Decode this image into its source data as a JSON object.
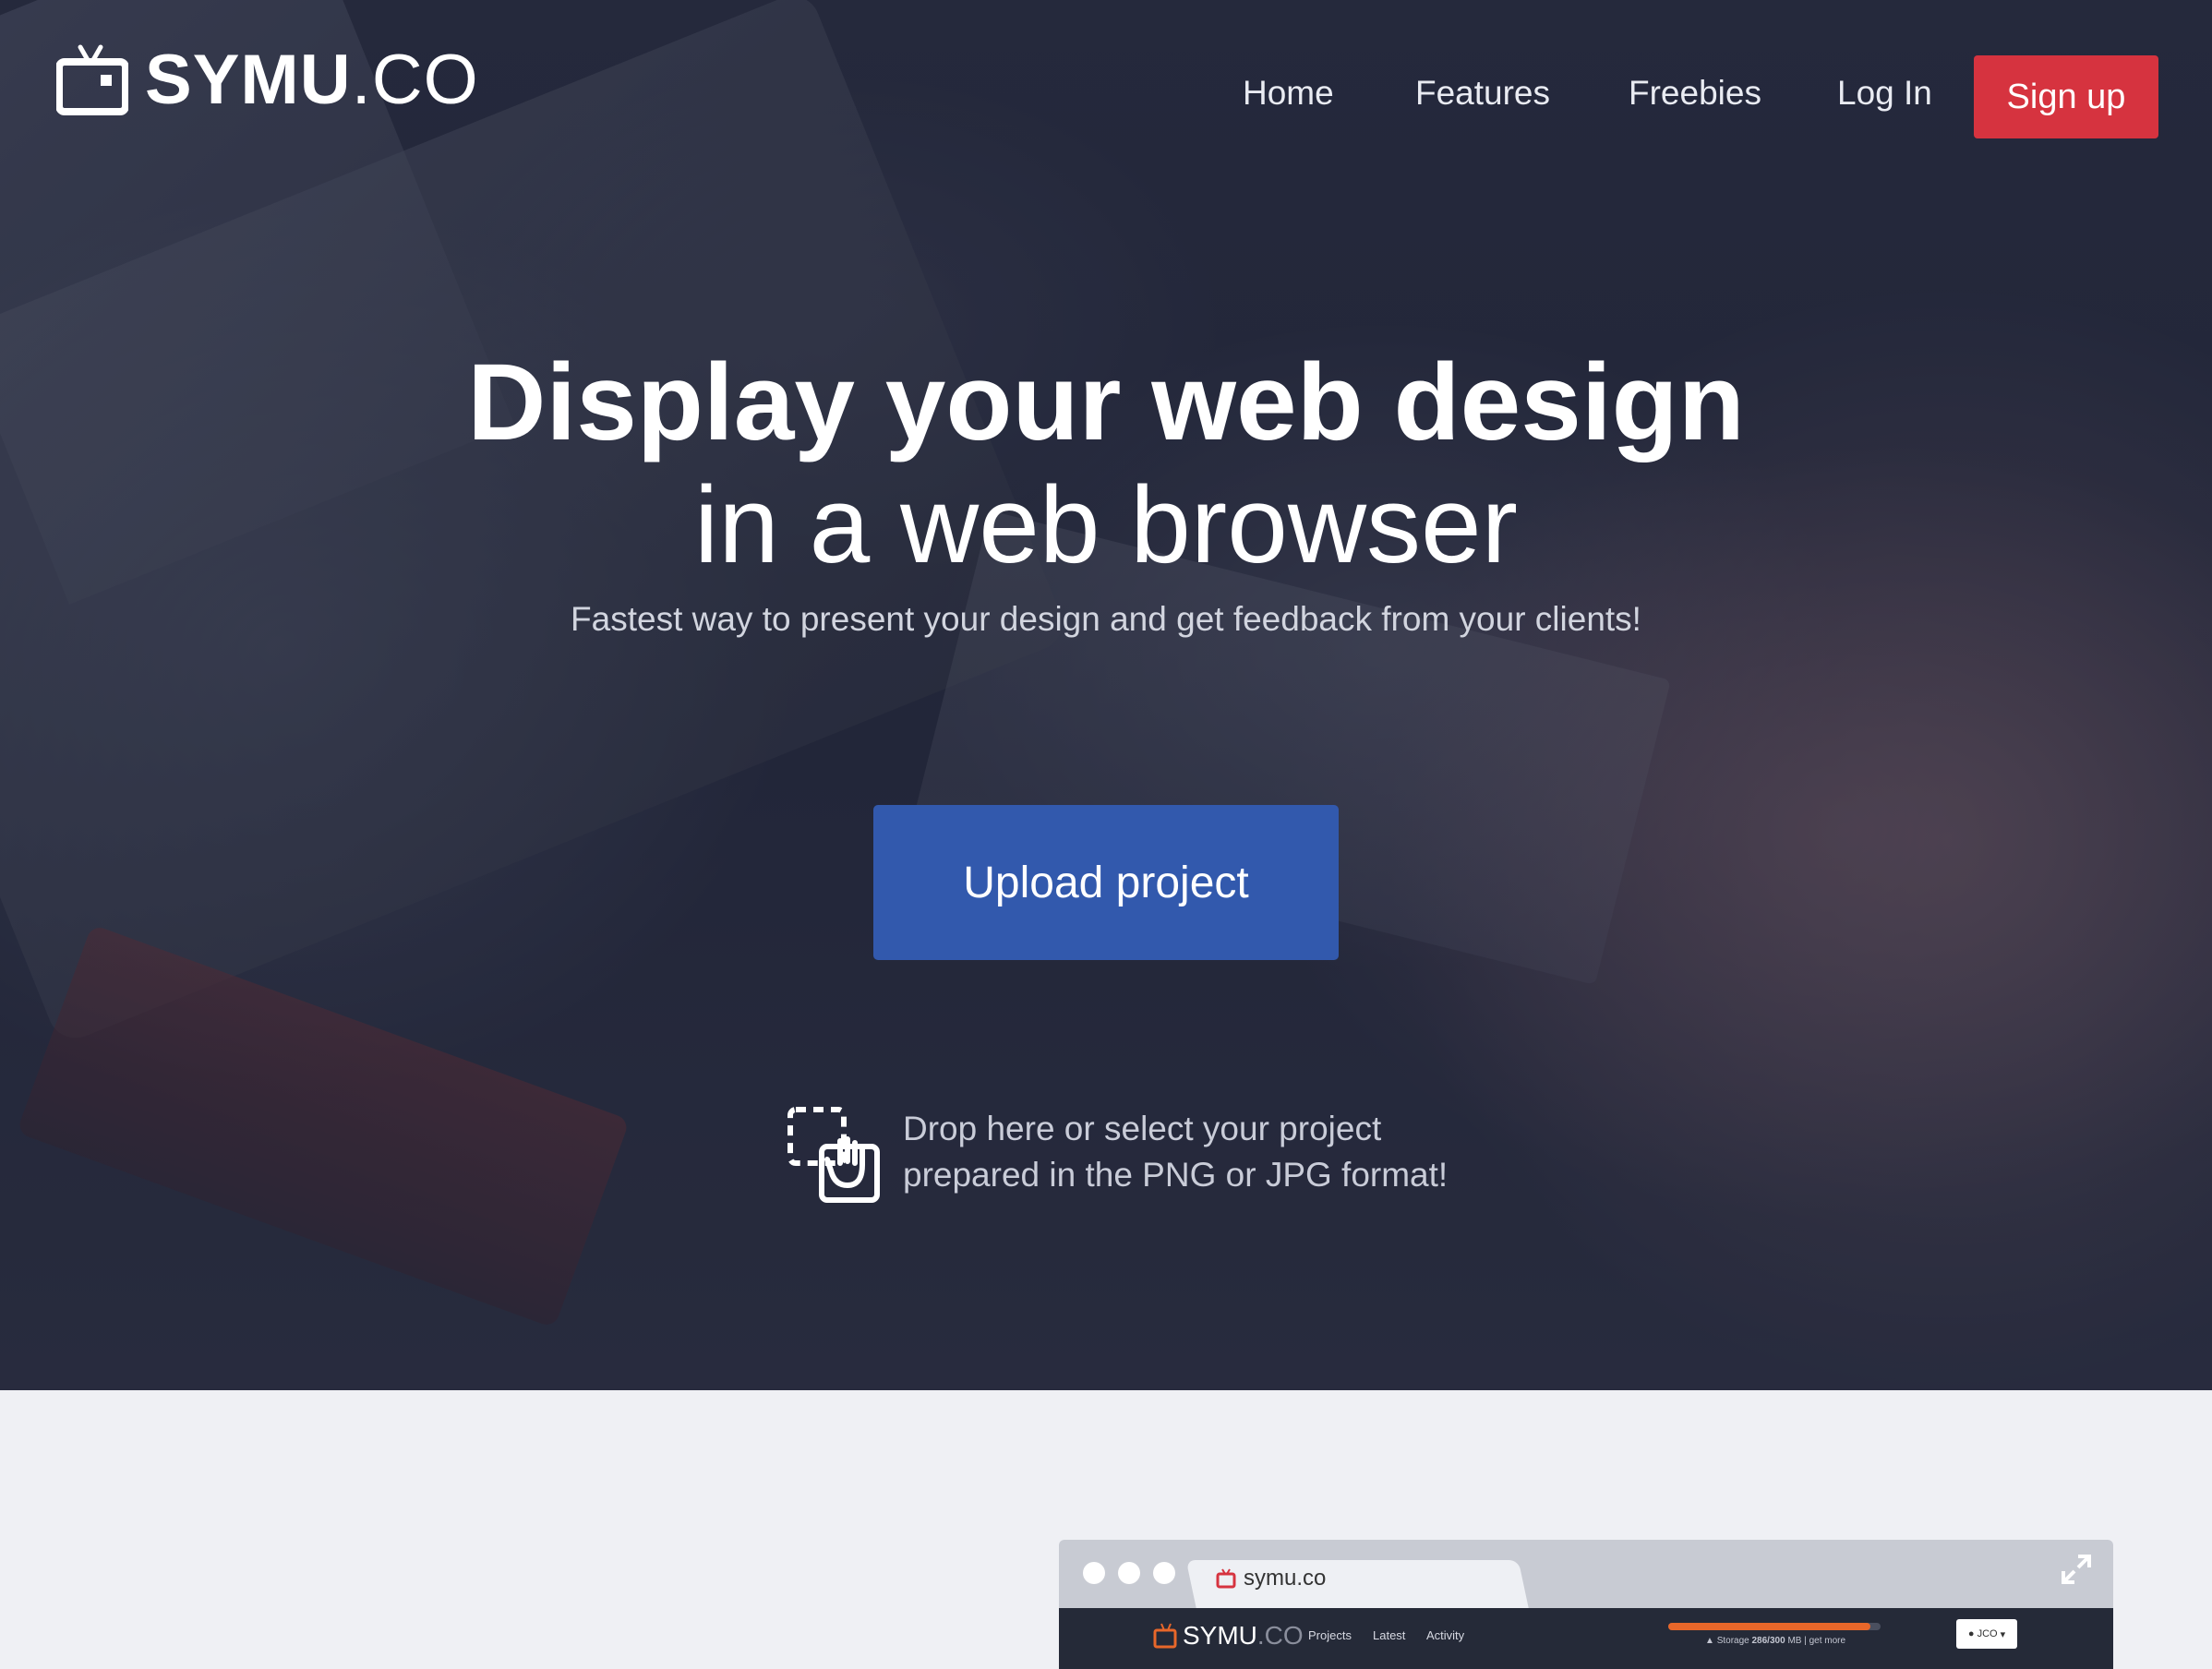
{
  "nav": {
    "brand_bold": "SYMU",
    "brand_light": ".CO",
    "links": [
      "Home",
      "Features",
      "Freebies",
      "Log In"
    ],
    "signup_label": "Sign up"
  },
  "hero": {
    "title_line1": "Display your web design",
    "title_line2": "in a web browser",
    "subtitle": "Fastest way to present your design and get feedback from your clients!",
    "upload_label": "Upload project",
    "drop_line1": "Drop here or select your project",
    "drop_line2": "prepared in the PNG or JPG format!"
  },
  "browser_mockup": {
    "tab_label": "symu.co",
    "app_brand_bold": "SYMU",
    "app_brand_light": ".CO",
    "app_nav": [
      "Projects",
      "Latest",
      "Activity"
    ],
    "storage_label": "Storage",
    "storage_value": "286/300",
    "storage_unit": "MB",
    "storage_link": "get more",
    "storage_fraction": 0.95,
    "user_label": "JCO"
  },
  "colors": {
    "signup": "#d6333f",
    "upload": "#3259ad",
    "storage_bar": "#e8672a"
  },
  "icons": [
    "tv-logo-icon",
    "drag-drop-icon",
    "expand-icon"
  ]
}
